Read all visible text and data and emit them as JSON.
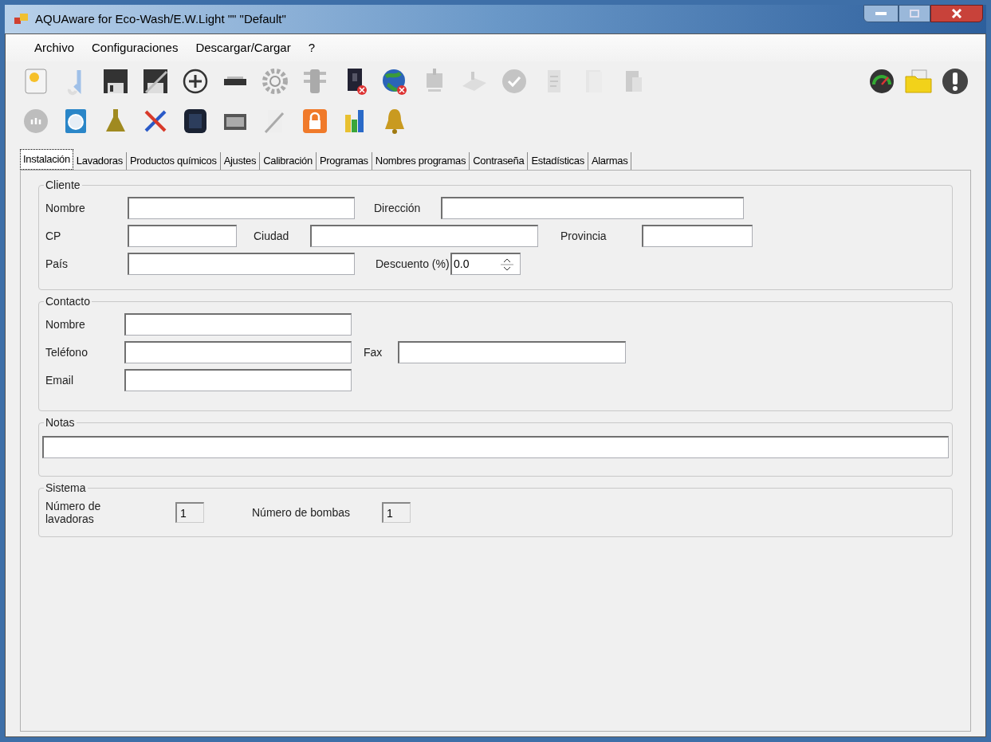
{
  "window": {
    "title": "AQUAware for Eco-Wash/E.W.Light \"\" \"Default\""
  },
  "menu": [
    "Archivo",
    "Configuraciones",
    "Descargar/Cargar",
    "?"
  ],
  "tabs": [
    {
      "label": "Instalación",
      "selected": true
    },
    {
      "label": "Lavadoras",
      "selected": false
    },
    {
      "label": "Productos químicos",
      "selected": false
    },
    {
      "label": "Ajustes",
      "selected": false
    },
    {
      "label": "Calibración",
      "selected": false
    },
    {
      "label": "Programas",
      "selected": false
    },
    {
      "label": "Nombres programas",
      "selected": false
    },
    {
      "label": "Contraseña",
      "selected": false
    },
    {
      "label": "Estadísticas",
      "selected": false
    },
    {
      "label": "Alarmas",
      "selected": false
    }
  ],
  "cliente": {
    "title": "Cliente",
    "nombre": "Nombre",
    "direccion": "Dirección",
    "cp": "CP",
    "ciudad": "Ciudad",
    "provincia": "Provincia",
    "pais": "País",
    "descuento": "Descuento (%)",
    "descuento_value": "0.0"
  },
  "contacto": {
    "title": "Contacto",
    "nombre": "Nombre",
    "telefono": "Teléfono",
    "fax": "Fax",
    "email": "Email"
  },
  "notas": {
    "title": "Notas"
  },
  "sistema": {
    "title": "Sistema",
    "lavadoras": "Número de lavadoras",
    "lavadoras_value": "1",
    "bombas": "Número de bombas",
    "bombas_value": "1"
  }
}
